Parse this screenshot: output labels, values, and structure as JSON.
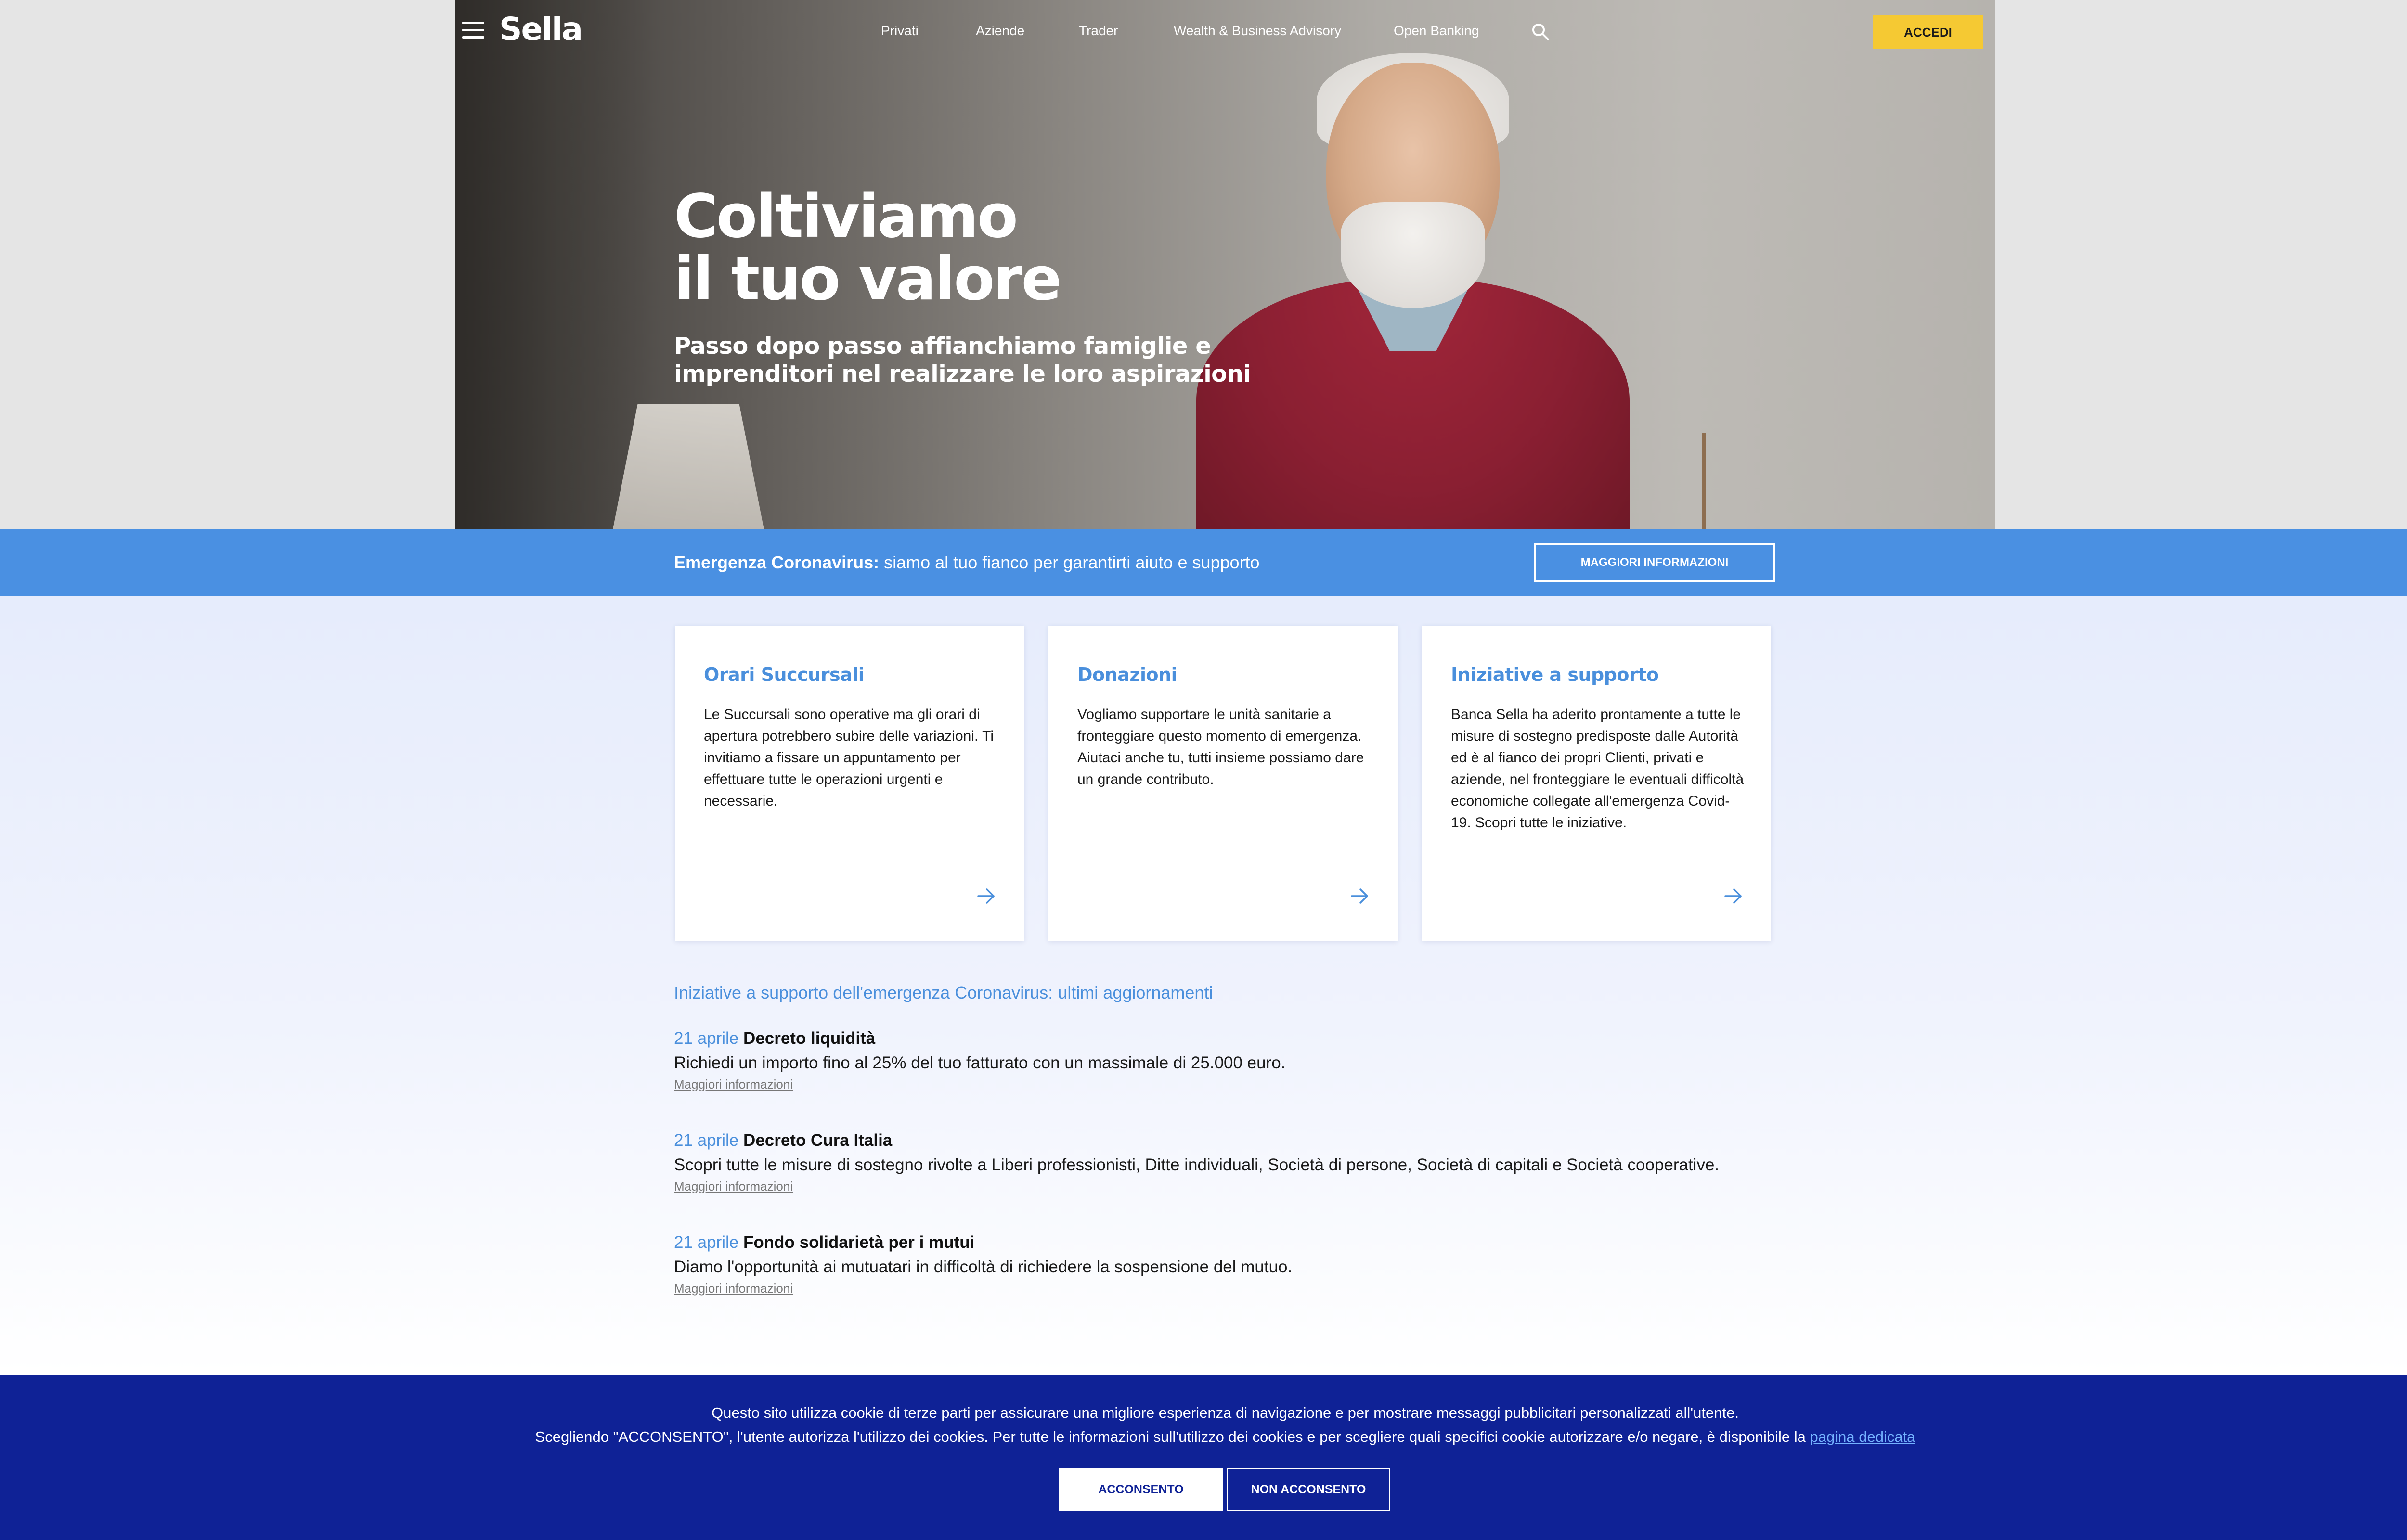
{
  "header": {
    "logo": "Sella",
    "nav": [
      "Privati",
      "Aziende",
      "Trader",
      "Wealth & Business Advisory",
      "Open Banking"
    ],
    "login_label": "ACCEDI"
  },
  "hero": {
    "heading_line1": "Coltiviamo",
    "heading_line2": "il tuo valore",
    "sub_line1": "Passo dopo passo affianchiamo famiglie e",
    "sub_line2": "imprenditori nel realizzare le loro aspirazioni"
  },
  "banner": {
    "bold": "Emergenza Coronavirus:",
    "text": " siamo al tuo fianco per garantirti aiuto e supporto",
    "button": "MAGGIORI INFORMAZIONI"
  },
  "cards": [
    {
      "title": "Orari Succursali",
      "body": "Le Succursali sono operative ma gli orari di apertura potrebbero subire delle variazioni. Ti invitiamo a fissare un appuntamento per effettuare tutte le operazioni urgenti e necessarie."
    },
    {
      "title": "Donazioni",
      "body": "Vogliamo supportare le unità sanitarie a fronteggiare questo momento di emergenza. Aiutaci anche tu, tutti insieme possiamo dare un grande contributo."
    },
    {
      "title": "Iniziative a supporto",
      "body": "Banca Sella ha aderito prontamente a tutte le misure di sostegno predisposte dalle Autorità ed è al fianco dei propri Clienti, privati e aziende, nel fronteggiare le eventuali difficoltà economiche collegate all'emergenza Covid-19. Scopri tutte le iniziative."
    }
  ],
  "updates": {
    "title": "Iniziative a supporto dell'emergenza Coronavirus: ultimi aggiornamenti",
    "items": [
      {
        "date": "21 aprile",
        "name": "Decreto liquidità",
        "desc": "Richiedi un importo fino al 25% del tuo fatturato con un massimale di 25.000 euro.",
        "link": "Maggiori informazioni"
      },
      {
        "date": "21 aprile",
        "name": "Decreto Cura Italia",
        "desc": "Scopri tutte le misure di sostegno rivolte a Liberi professionisti, Ditte individuali, Società di persone, Società di capitali e Società cooperative.",
        "link": "Maggiori informazioni"
      },
      {
        "date": "21 aprile",
        "name": "Fondo solidarietà per i mutui",
        "desc": "Diamo l'opportunità ai mutuatari in difficoltà di richiedere la sospensione del mutuo.",
        "link": "Maggiori informazioni"
      }
    ]
  },
  "cookie": {
    "line1": "Questo sito utilizza cookie di terze parti per assicurare una migliore esperienza di navigazione e per mostrare messaggi pubblicitari personalizzati all'utente.",
    "line2": "Scegliendo \"ACCONSENTO\", l'utente autorizza l'utilizzo dei cookies. Per tutte le informazioni sull'utilizzo dei cookies e per scegliere quali specifici cookie autorizzare e/o negare, è disponibile la ",
    "link": "pagina dedicata",
    "accept": "ACCONSENTO",
    "reject": "NON ACCONSENTO"
  },
  "colors": {
    "accent_blue": "#4a90e2",
    "login_yellow": "#f5c933",
    "cookie_navy": "#0f2296"
  },
  "icons": [
    "menu-icon",
    "search-icon",
    "arrow-right-icon"
  ]
}
